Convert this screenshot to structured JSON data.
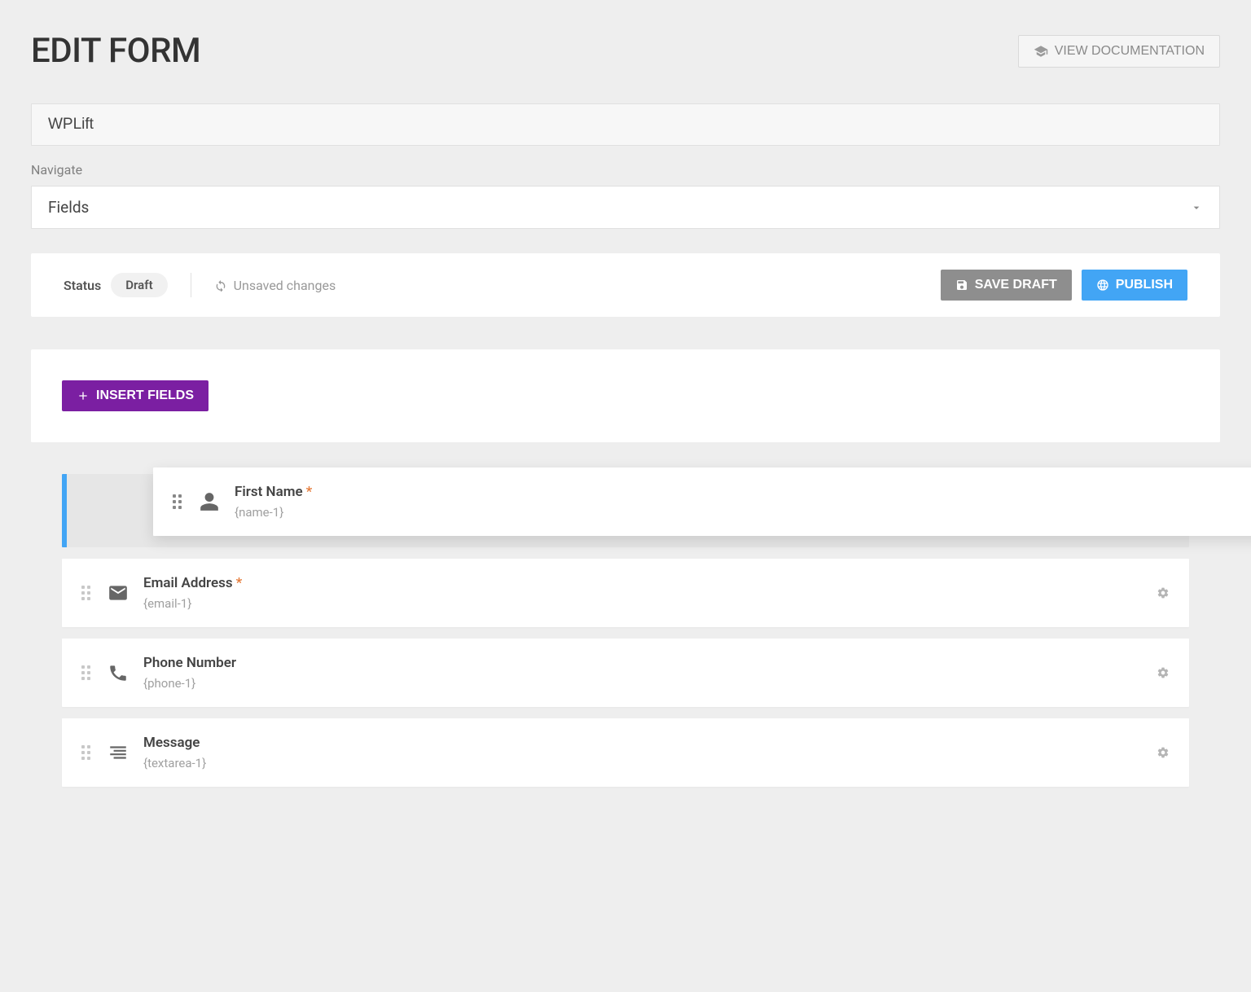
{
  "header": {
    "title": "EDIT FORM",
    "doc_button": "VIEW DOCUMENTATION"
  },
  "form_title": "WPLift",
  "navigate": {
    "label": "Navigate",
    "value": "Fields"
  },
  "status_bar": {
    "status_label": "Status",
    "status_value": "Draft",
    "unsaved": "Unsaved changes",
    "save_draft": "SAVE DRAFT",
    "publish": "PUBLISH"
  },
  "insert_fields_label": "INSERT FIELDS",
  "fields": [
    {
      "label": "First Name",
      "slug": "{name-1}",
      "required": true,
      "icon": "person",
      "dragging": true
    },
    {
      "label": "Email Address",
      "slug": "{email-1}",
      "required": true,
      "icon": "envelope",
      "dragging": false
    },
    {
      "label": "Phone Number",
      "slug": "{phone-1}",
      "required": false,
      "icon": "phone",
      "dragging": false
    },
    {
      "label": "Message",
      "slug": "{textarea-1}",
      "required": false,
      "icon": "textarea",
      "dragging": false
    }
  ]
}
